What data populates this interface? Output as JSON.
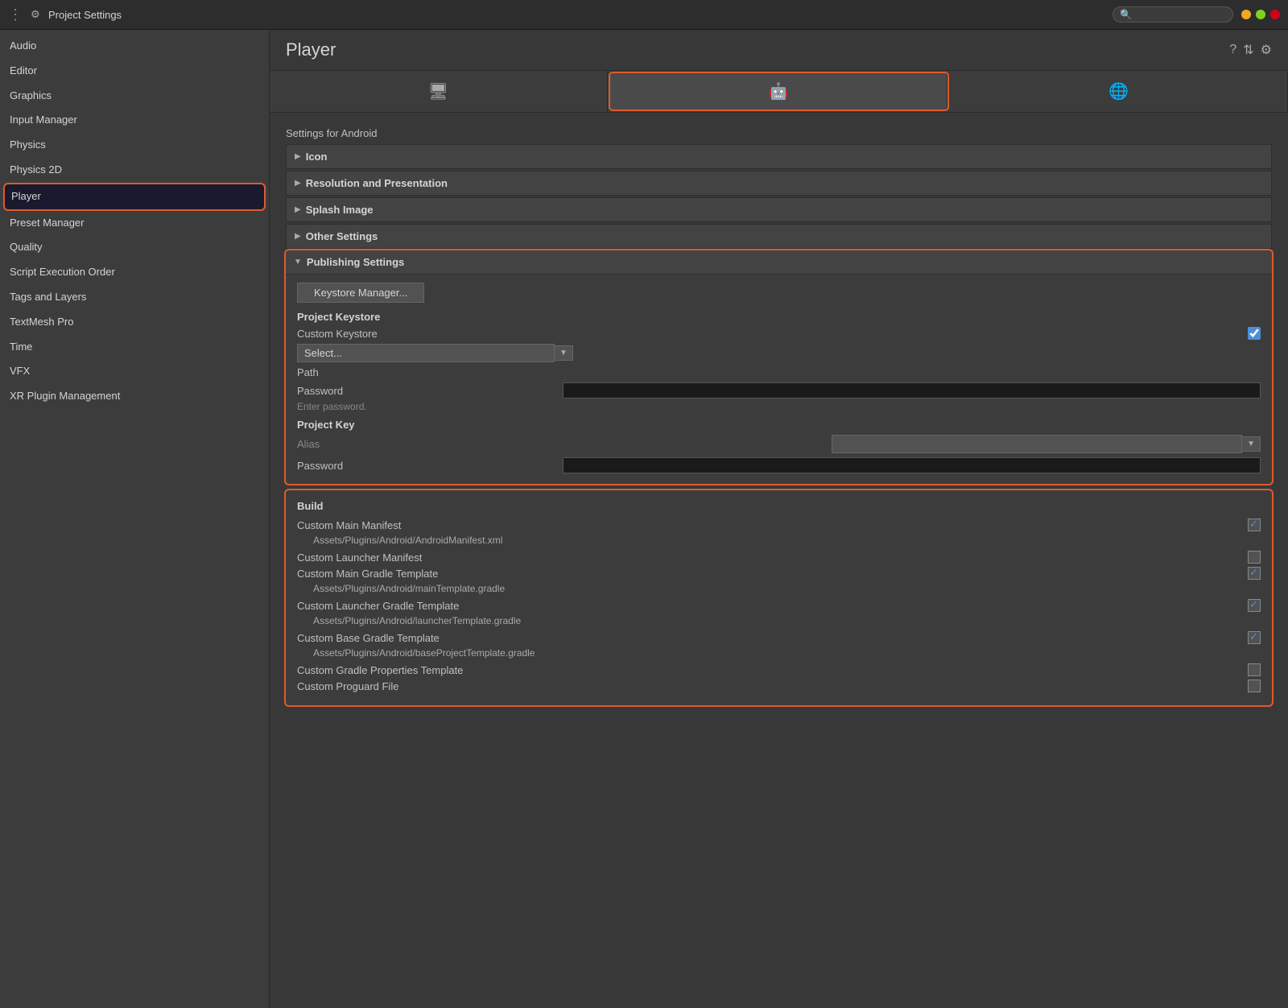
{
  "titlebar": {
    "title": "Project Settings",
    "dots": "⋮"
  },
  "sidebar": {
    "items": [
      {
        "label": "Audio",
        "active": false
      },
      {
        "label": "Editor",
        "active": false
      },
      {
        "label": "Graphics",
        "active": false
      },
      {
        "label": "Input Manager",
        "active": false
      },
      {
        "label": "Physics",
        "active": false
      },
      {
        "label": "Physics 2D",
        "active": false
      },
      {
        "label": "Player",
        "active": true
      },
      {
        "label": "Preset Manager",
        "active": false
      },
      {
        "label": "Quality",
        "active": false
      },
      {
        "label": "Script Execution Order",
        "active": false
      },
      {
        "label": "Tags and Layers",
        "active": false
      },
      {
        "label": "TextMesh Pro",
        "active": false
      },
      {
        "label": "Time",
        "active": false
      },
      {
        "label": "VFX",
        "active": false
      },
      {
        "label": "XR Plugin Management",
        "active": false
      }
    ]
  },
  "main": {
    "title": "Player",
    "settings_for": "Settings for Android",
    "platform_tabs": [
      {
        "name": "desktop",
        "icon": "🖥"
      },
      {
        "name": "android",
        "icon": "🤖",
        "active": true
      },
      {
        "name": "web",
        "icon": "🌐"
      }
    ],
    "sections": {
      "icon": {
        "label": "Icon"
      },
      "resolution": {
        "label": "Resolution and Presentation"
      },
      "splash": {
        "label": "Splash Image"
      },
      "other": {
        "label": "Other Settings"
      }
    },
    "publishing": {
      "title": "Publishing Settings",
      "keystore_btn": "Keystore Manager...",
      "project_keystore_label": "Project Keystore",
      "custom_keystore_label": "Custom Keystore",
      "select_placeholder": "Select...",
      "path_label": "Path",
      "password_label": "Password",
      "password_hint": "Enter password.",
      "project_key_label": "Project Key",
      "alias_label": "Alias",
      "key_password_label": "Password"
    },
    "build": {
      "title": "Build",
      "items": [
        {
          "label": "Custom Main Manifest",
          "checked": true,
          "path": "Assets/Plugins/Android/AndroidManifest.xml"
        },
        {
          "label": "Custom Launcher Manifest",
          "checked": false,
          "path": null
        },
        {
          "label": "Custom Main Gradle Template",
          "checked": true,
          "path": "Assets/Plugins/Android/mainTemplate.gradle"
        },
        {
          "label": "Custom Launcher Gradle Template",
          "checked": true,
          "path": "Assets/Plugins/Android/launcherTemplate.gradle"
        },
        {
          "label": "Custom Base Gradle Template",
          "checked": true,
          "path": "Assets/Plugins/Android/baseProjectTemplate.gradle"
        },
        {
          "label": "Custom Gradle Properties Template",
          "checked": false,
          "path": null
        },
        {
          "label": "Custom Proguard File",
          "checked": false,
          "path": null
        }
      ]
    }
  }
}
